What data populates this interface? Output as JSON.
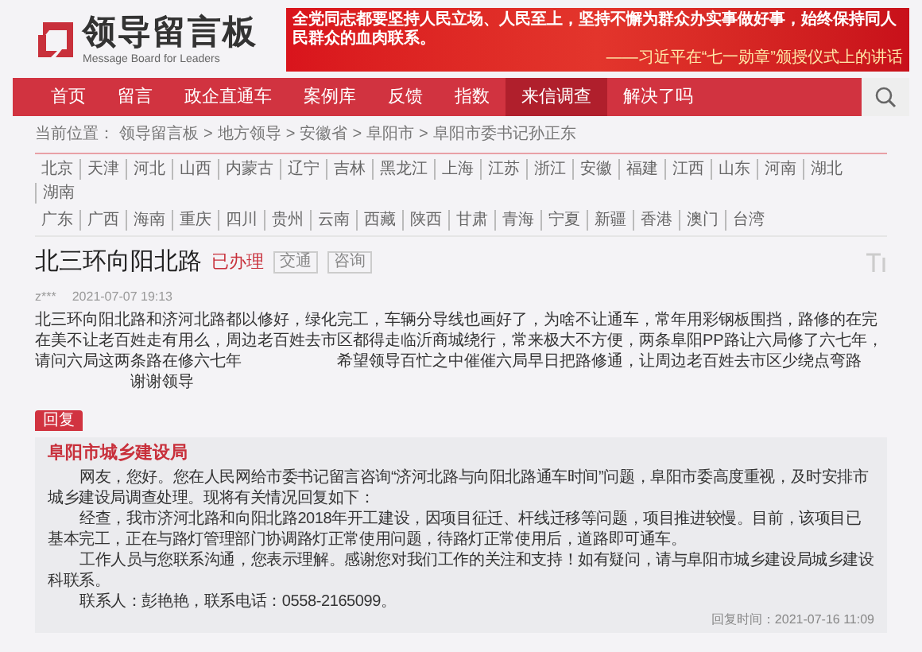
{
  "logo": {
    "title": "领导留言板",
    "subtitle": "Message Board for Leaders"
  },
  "banner": {
    "quote": "全党同志都要坚持人民立场、人民至上，坚持不懈为群众办实事做好事，始终保持同人民群众的血肉联系。",
    "source": "——习近平在“七一勋章”颁授仪式上的讲话"
  },
  "nav": [
    {
      "label": "首页",
      "selected": false
    },
    {
      "label": "留言",
      "selected": false
    },
    {
      "label": "政企直通车",
      "selected": false
    },
    {
      "label": "案例库",
      "selected": false
    },
    {
      "label": "反馈",
      "selected": false
    },
    {
      "label": "指数",
      "selected": false
    },
    {
      "label": "来信调查",
      "selected": true
    },
    {
      "label": "解决了吗",
      "selected": false
    }
  ],
  "breadcrumb": {
    "prefix": "当前位置：",
    "separator": ">",
    "items": [
      "领导留言板",
      "地方领导",
      "安徽省",
      "阜阳市",
      "阜阳市委书记孙正东"
    ]
  },
  "regions": [
    "北京",
    "天津",
    "河北",
    "山西",
    "内蒙古",
    "辽宁",
    "吉林",
    "黑龙江",
    "上海",
    "江苏",
    "浙江",
    "安徽",
    "福建",
    "江西",
    "山东",
    "河南",
    "湖北",
    "湖南",
    "广东",
    "广西",
    "海南",
    "重庆",
    "四川",
    "贵州",
    "云南",
    "西藏",
    "陕西",
    "甘肃",
    "青海",
    "宁夏",
    "新疆",
    "香港",
    "澳门",
    "台湾"
  ],
  "message": {
    "title": "北三环向阳北路",
    "status": "已办理",
    "tags": [
      "交通",
      "咨询"
    ],
    "author": "z***",
    "time": "2021-07-07 19:13",
    "body": [
      "北三环向阳北路和济河北路都以修好，绿化完工，车辆分导线也画好了，为啥不让通车，常年用彩钢板围挡，路修的在完在美不让老百姓走有用么，周边老百姓去市区都得走临沂商城绕行，常来极大不方便，两条阜阳PP路让六局修了六七年，请问六局这两条路在修六七年",
      "希望领导百忙之中催催六局早日把路修通，让周边老百姓去市区少绕点弯路",
      "谢谢领导"
    ]
  },
  "reply": {
    "label": "回复",
    "org": "阜阳市城乡建设局",
    "paragraphs": [
      "网友，您好。您在人民网给市委书记留言咨询“济河北路与向阳北路通车时间”问题，阜阳市委高度重视，及时安排市城乡建设局调查处理。现将有关情况回复如下：",
      "经查，我市济河北路和向阳北路2018年开工建设，因项目征迁、杆线迁移等问题，项目推进较慢。目前，该项目已基本完工，正在与路灯管理部门协调路灯正常使用问题，待路灯正常使用后，道路即可通车。",
      "工作人员与您联系沟通，您表示理解。感谢您对我们工作的关注和支持！如有疑问，请与阜阳市城乡建设局城乡建设科联系。",
      "联系人：彭艳艳，联系电话：0558-2165099。"
    ],
    "time": "回复时间：2021-07-16 11:09"
  }
}
